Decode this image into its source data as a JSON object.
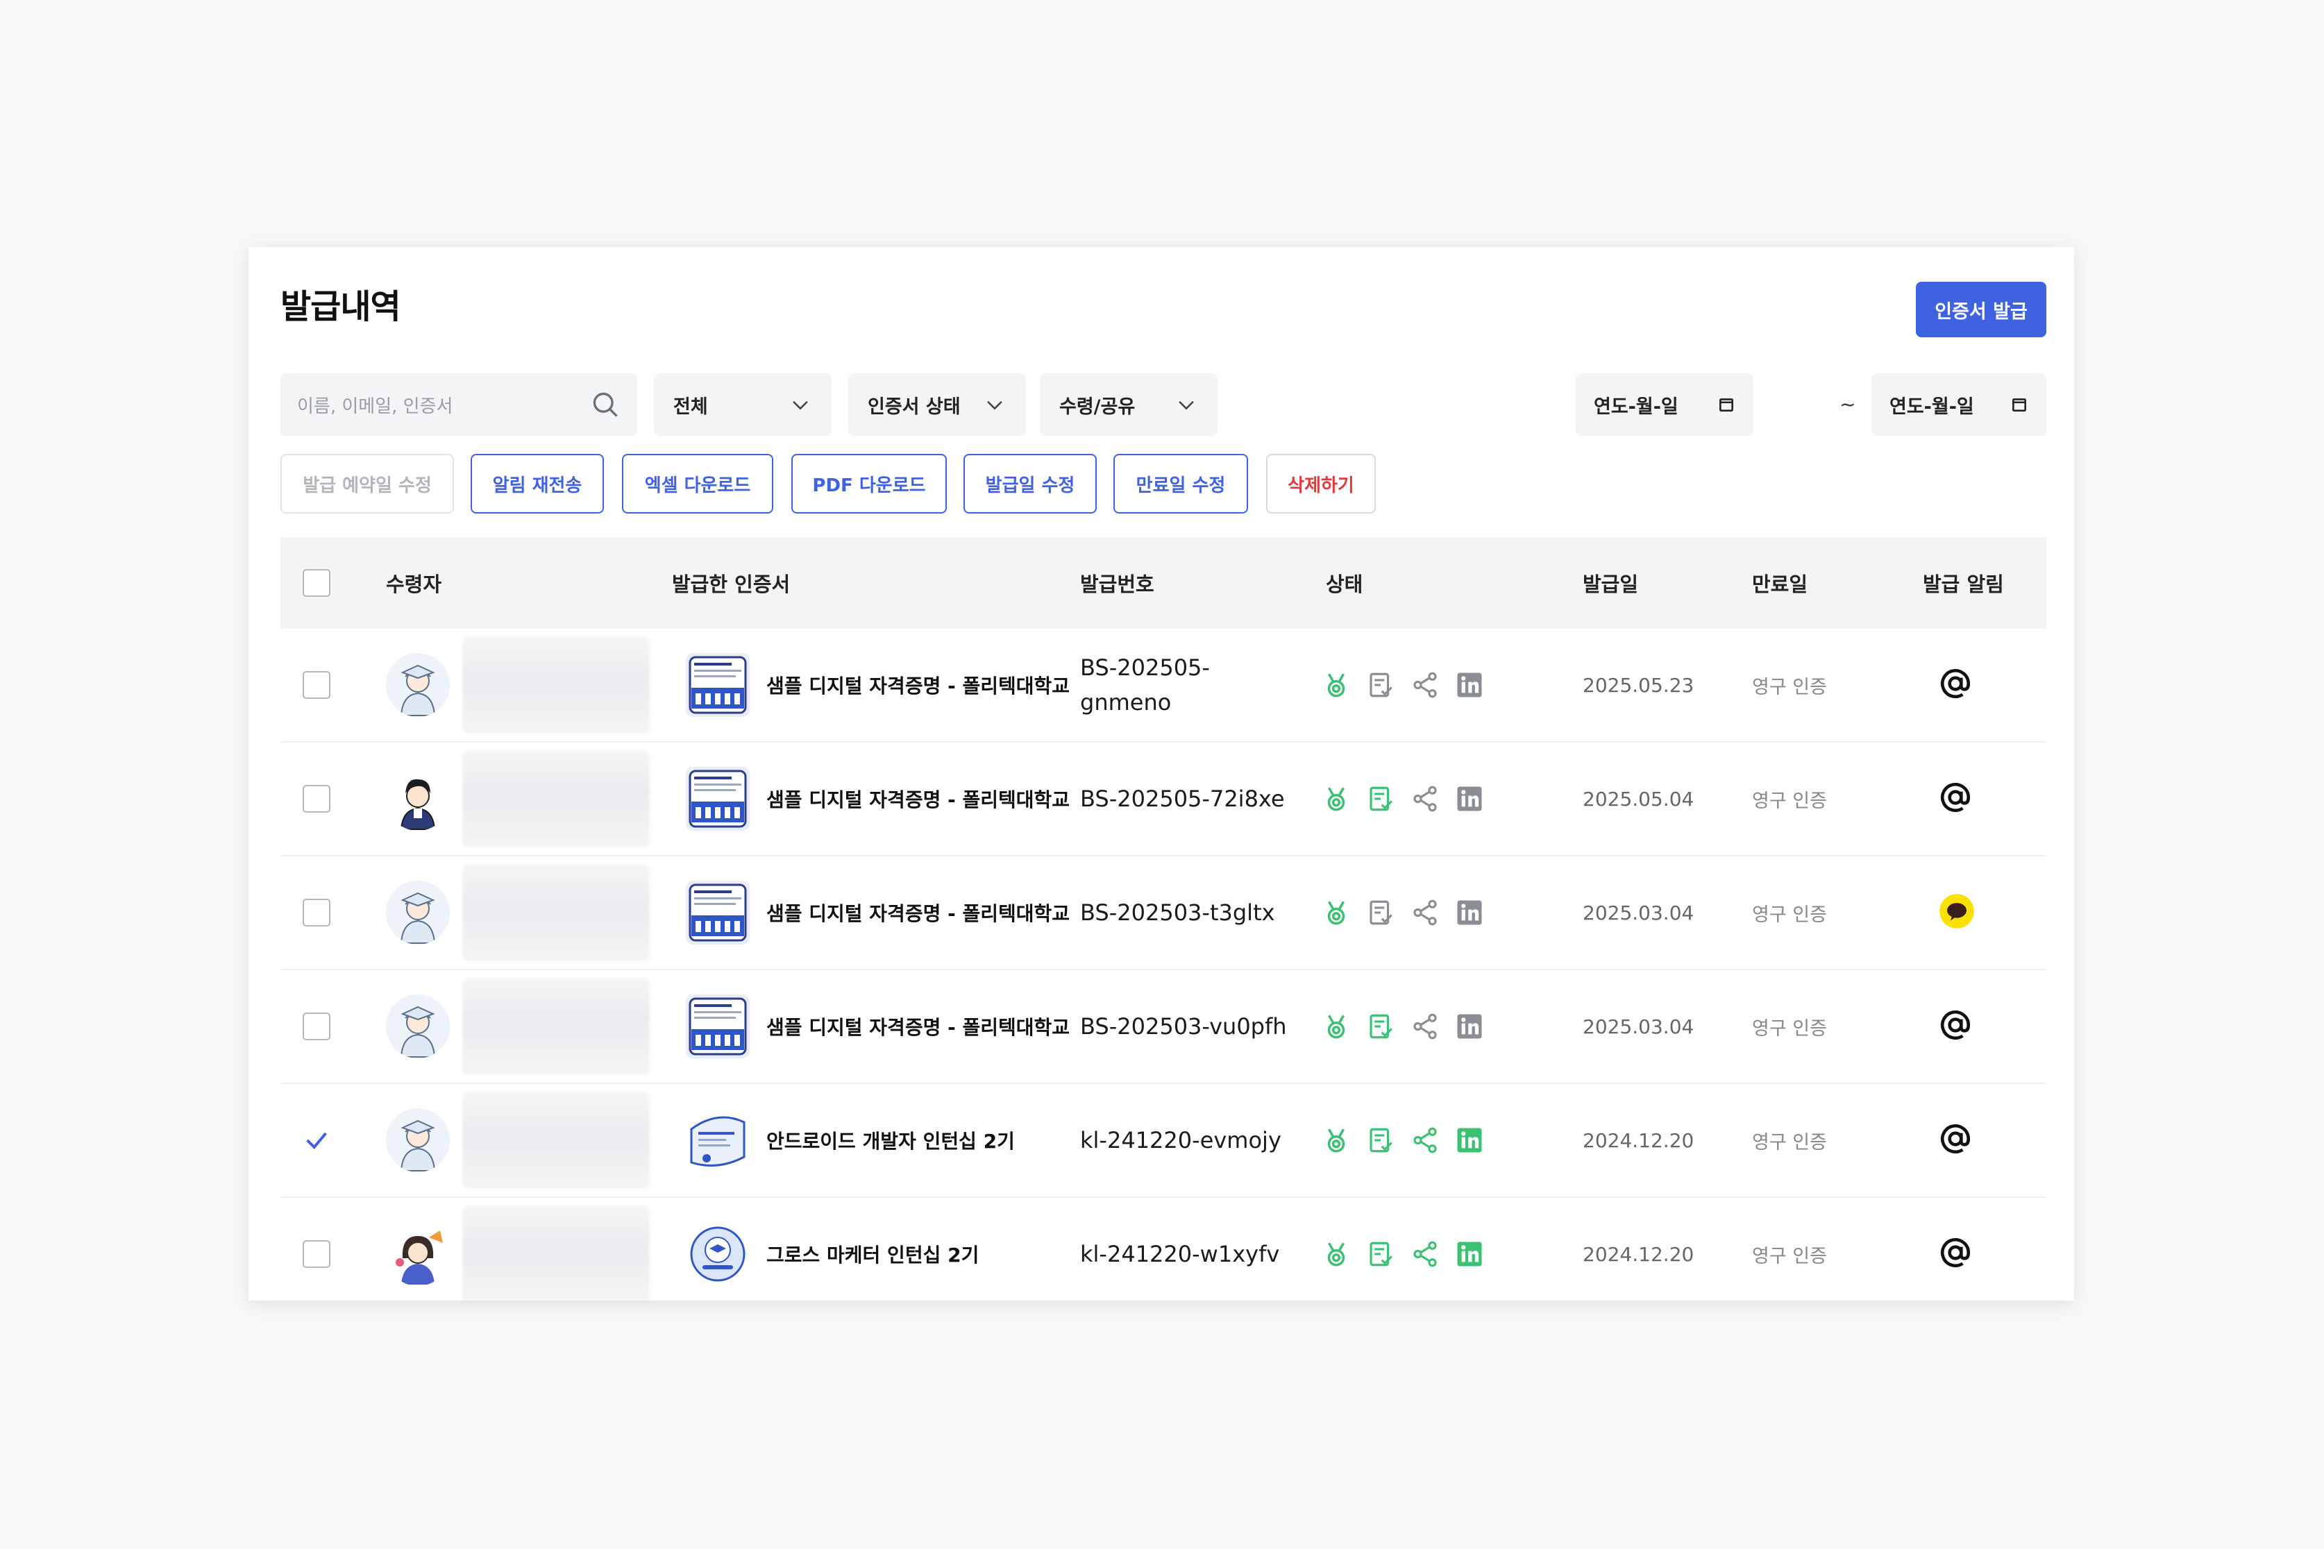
{
  "page": {
    "title": "발급내역",
    "issue_button": "인증서 발급"
  },
  "filters": {
    "search_placeholder": "이름, 이메일, 인증서",
    "dropdown_all": "전체",
    "dropdown_status": "인증서 상태",
    "dropdown_share": "수령/공유",
    "date_from_placeholder": "연도-월-일",
    "date_separator": "~",
    "date_to_placeholder": "연도-월-일"
  },
  "actions": {
    "edit_reserved": "발급 예약일 수정",
    "resend": "알림 재전송",
    "excel": "엑셀 다운로드",
    "pdf": "PDF 다운로드",
    "edit_issue": "발급일 수정",
    "edit_expiry": "만료일 수정",
    "delete": "삭제하기"
  },
  "table": {
    "headers": {
      "recipient": "수령자",
      "certificate": "발급한 인증서",
      "number": "발급번호",
      "status": "상태",
      "issued": "발급일",
      "expiry": "만료일",
      "notify": "발급 알림"
    },
    "rows": [
      {
        "checked": false,
        "avatar": "student-avatar-light",
        "thumb": "certificate-doc",
        "certificate": "샘플 디지털 자격증명 - 폴리텍대학교",
        "number_line1": "BS-202505-",
        "number_line2": "gnmeno",
        "linkedin_active": false,
        "issued": "2025.05.23",
        "expiry": "영구 인증",
        "notify": "email"
      },
      {
        "checked": false,
        "avatar": "student-avatar-dark",
        "thumb": "certificate-doc",
        "certificate": "샘플 디지털 자격증명 - 폴리텍대학교",
        "number_line1": "BS-202505-72i8xe",
        "number_line2": "",
        "linkedin_active": false,
        "issued": "2025.05.04",
        "expiry": "영구 인증",
        "notify": "email"
      },
      {
        "checked": false,
        "avatar": "student-avatar-light",
        "thumb": "certificate-doc",
        "certificate": "샘플 디지털 자격증명 - 폴리텍대학교",
        "number_line1": "BS-202503-t3gltx",
        "number_line2": "",
        "linkedin_active": false,
        "issued": "2025.03.04",
        "expiry": "영구 인증",
        "notify": "kakao"
      },
      {
        "checked": false,
        "avatar": "student-avatar-light",
        "thumb": "certificate-doc",
        "certificate": "샘플 디지털 자격증명 - 폴리텍대학교",
        "number_line1": "BS-202503-vu0pfh",
        "number_line2": "",
        "linkedin_active": false,
        "issued": "2025.03.04",
        "expiry": "영구 인증",
        "notify": "email"
      },
      {
        "checked": true,
        "avatar": "student-avatar-light",
        "thumb": "certificate-card",
        "certificate": "안드로이드 개발자 인턴십 2기",
        "number_line1": "kl-241220-evmojy",
        "number_line2": "",
        "linkedin_active": true,
        "issued": "2024.12.20",
        "expiry": "영구 인증",
        "notify": "email"
      },
      {
        "checked": false,
        "avatar": "student-avatar-girl",
        "thumb": "certificate-badge",
        "certificate": "그로스 마케터 인턴십 2기",
        "number_line1": "kl-241220-w1xyfv",
        "number_line2": "",
        "linkedin_active": true,
        "issued": "2024.12.20",
        "expiry": "영구 인증",
        "notify": "email"
      }
    ]
  },
  "colors": {
    "accent": "#3f63e0",
    "green": "#3cc173",
    "gray_icon": "#8a8d93",
    "danger": "#e03b3b",
    "kakao": "#fae100"
  }
}
